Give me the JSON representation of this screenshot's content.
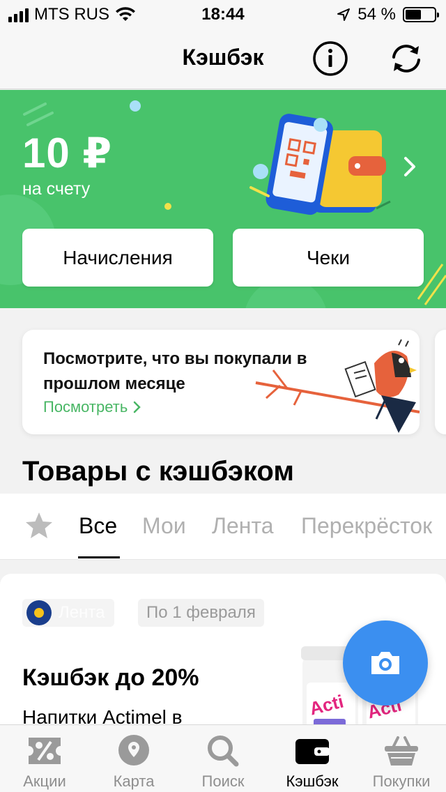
{
  "status_bar": {
    "carrier": "MTS RUS",
    "time": "18:44",
    "battery_text": "54 %",
    "battery_level": 0.54
  },
  "nav": {
    "title": "Кэшбэк",
    "info_icon": "info-icon",
    "refresh_icon": "refresh-icon"
  },
  "balance": {
    "amount": "10 ₽",
    "subtitle": "на счету",
    "buttons": [
      "Начисления",
      "Чеки"
    ]
  },
  "promo": {
    "text": "Посмотрите, что вы покупали в прошлом месяце",
    "link": "Посмотреть"
  },
  "section": {
    "title": "Товары с кэшбэком",
    "tabs": [
      "Все",
      "Мои",
      "Лента",
      "Перекрёсток"
    ],
    "active_tab": "Все"
  },
  "product": {
    "store": "Лента",
    "date": "По 1 февраля",
    "cashback": "Кэшбэк до 20%",
    "name": "Напитки Actimel в"
  },
  "tabbar": {
    "items": [
      {
        "label": "Акции",
        "icon": "percent-ticket-icon"
      },
      {
        "label": "Карта",
        "icon": "map-pin-icon"
      },
      {
        "label": "Поиск",
        "icon": "search-icon"
      },
      {
        "label": "Кэшбэк",
        "icon": "wallet-icon"
      },
      {
        "label": "Покупки",
        "icon": "basket-icon"
      }
    ],
    "active": "Кэшбэк"
  },
  "colors": {
    "brand_green": "#48c36b",
    "link_green": "#48b664",
    "fab_blue": "#3b8ff0"
  }
}
